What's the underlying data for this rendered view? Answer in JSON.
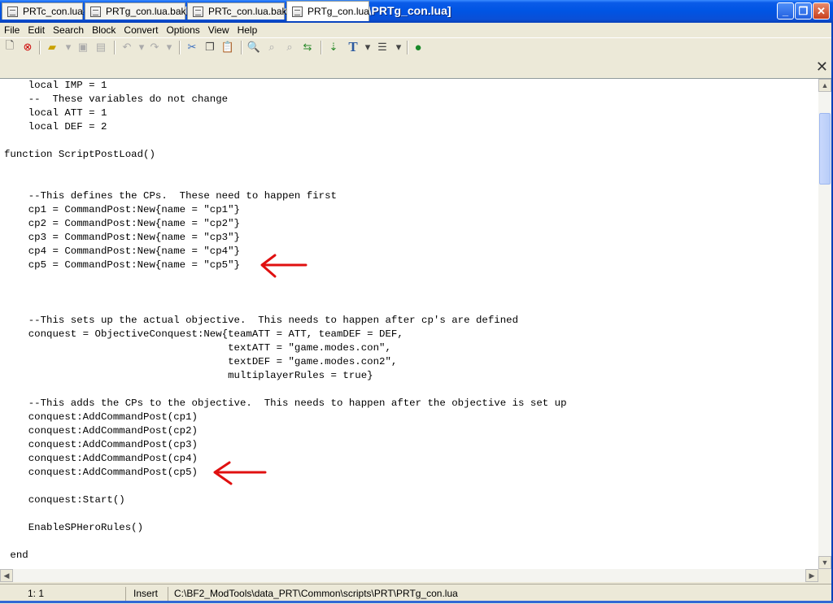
{
  "window": {
    "title": "EditPad Lite - [C:\\BF2_ModTools\\data_PRT\\Common\\scripts\\PRT\\PRTg_con.lua]"
  },
  "menu": [
    "File",
    "Edit",
    "Search",
    "Block",
    "Convert",
    "Options",
    "View",
    "Help"
  ],
  "tabs": [
    "PRTc_con.lua",
    "PRTg_con.lua.bak",
    "PRTc_con.lua.bak",
    "PRTg_con.lua"
  ],
  "active_tab": 3,
  "editor": {
    "lines": [
      "    local IMP = 1",
      "    --  These variables do not change",
      "    local ATT = 1",
      "    local DEF = 2",
      "",
      "function ScriptPostLoad()",
      "",
      "",
      "    --This defines the CPs.  These need to happen first",
      "    cp1 = CommandPost:New{name = \"cp1\"}",
      "    cp2 = CommandPost:New{name = \"cp2\"}",
      "    cp3 = CommandPost:New{name = \"cp3\"}",
      "    cp4 = CommandPost:New{name = \"cp4\"}",
      "    cp5 = CommandPost:New{name = \"cp5\"}",
      "",
      "",
      "",
      "    --This sets up the actual objective.  This needs to happen after cp's are defined",
      "    conquest = ObjectiveConquest:New{teamATT = ATT, teamDEF = DEF,",
      "                                     textATT = \"game.modes.con\",",
      "                                     textDEF = \"game.modes.con2\",",
      "                                     multiplayerRules = true}",
      "",
      "    --This adds the CPs to the objective.  This needs to happen after the objective is set up",
      "    conquest:AddCommandPost(cp1)",
      "    conquest:AddCommandPost(cp2)",
      "    conquest:AddCommandPost(cp3)",
      "    conquest:AddCommandPost(cp4)",
      "    conquest:AddCommandPost(cp5)",
      "",
      "    conquest:Start()",
      "",
      "    EnableSPHeroRules()",
      "",
      " end"
    ]
  },
  "status": {
    "position": "1: 1",
    "mode": "Insert",
    "path": "C:\\BF2_ModTools\\data_PRT\\Common\\scripts\\PRT\\PRTg_con.lua"
  },
  "colors": {
    "titlebar": "#0054e3",
    "annotation_arrow": "#e01010",
    "chrome": "#ece9d8"
  }
}
